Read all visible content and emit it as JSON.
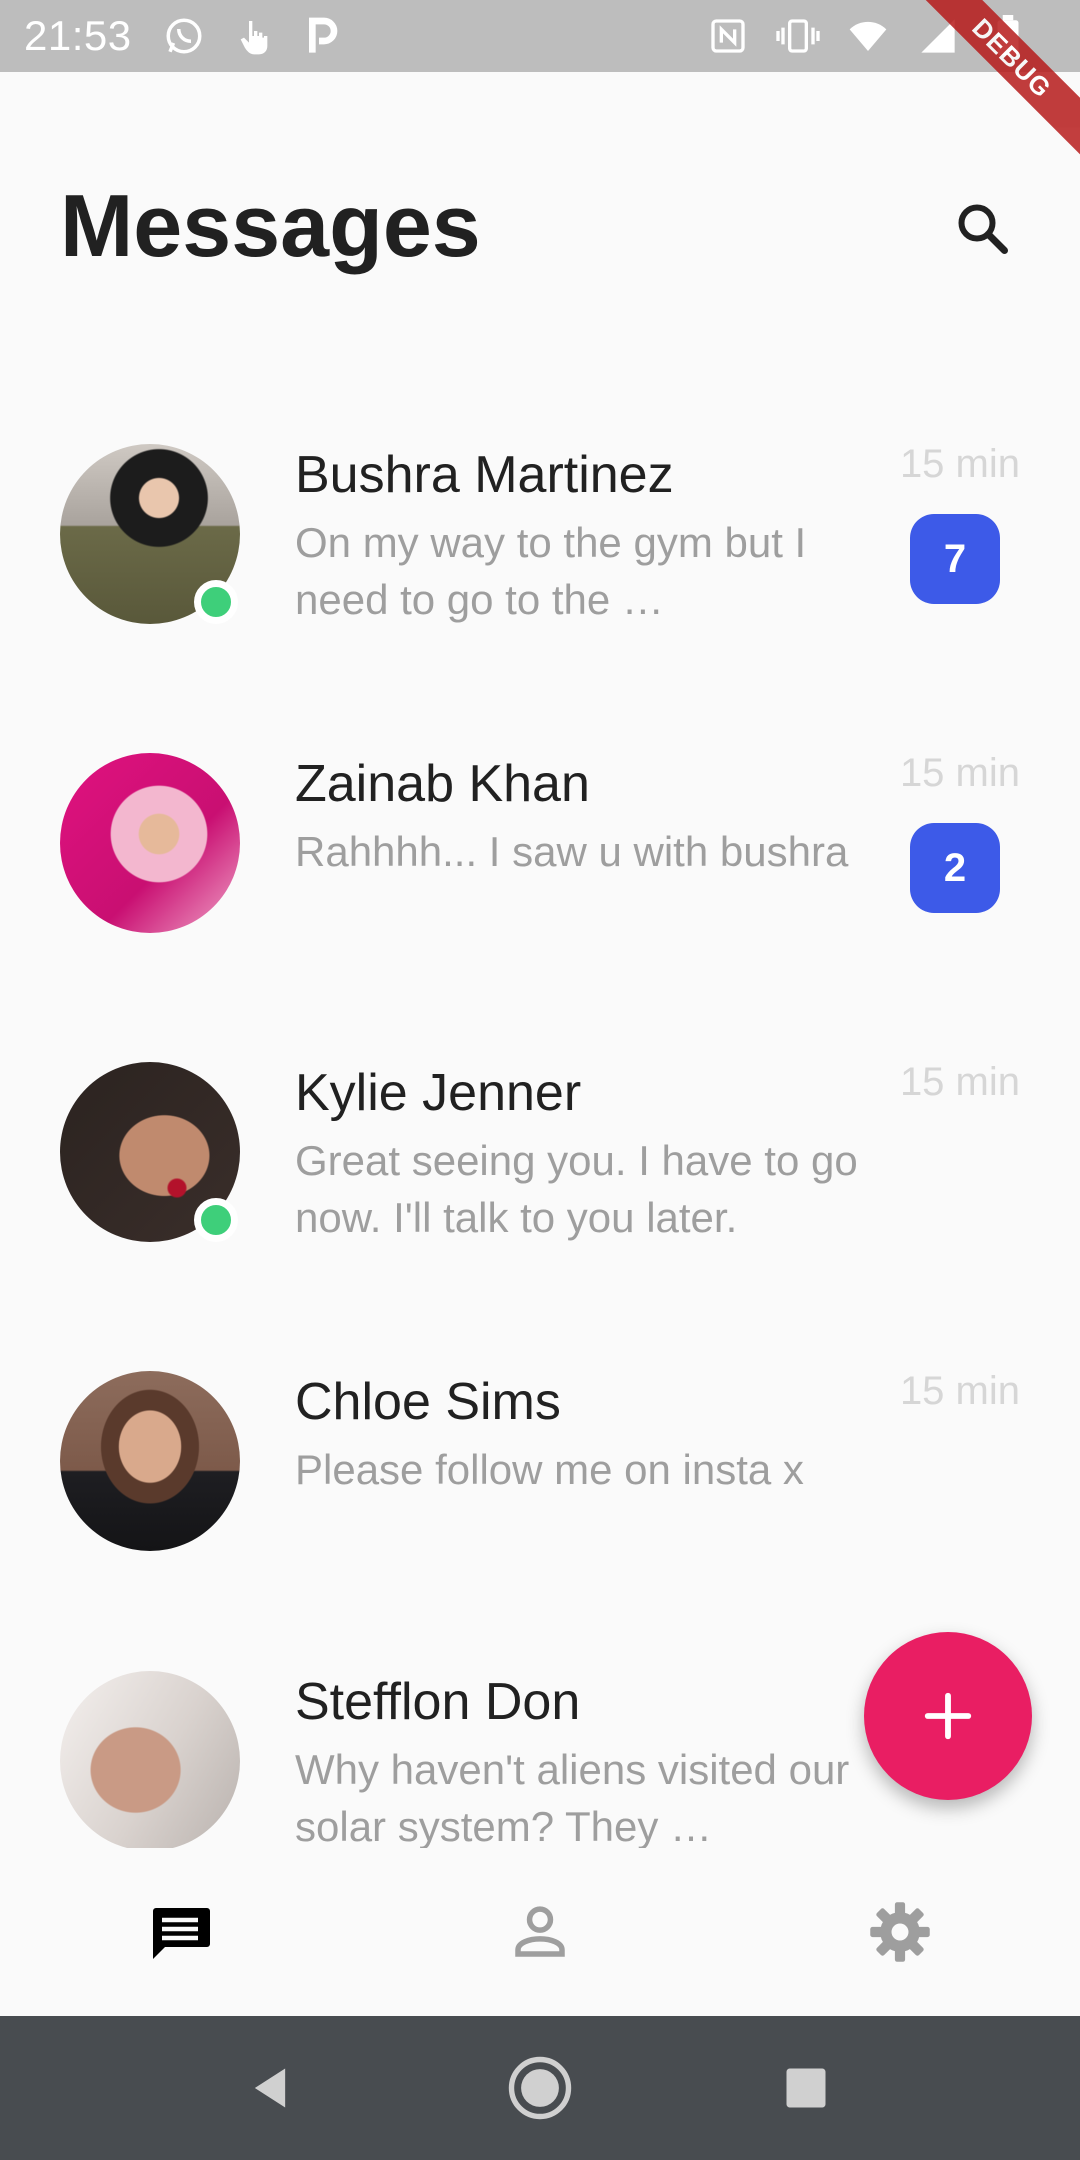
{
  "status_bar": {
    "time": "21:53",
    "left_icons": [
      "whatsapp-icon",
      "touch-icon",
      "parking-icon"
    ],
    "right_icons": [
      "nfc-icon",
      "vibrate-icon",
      "wifi-icon",
      "signal-icon",
      "battery-icon"
    ],
    "debug_label": "DEBUG"
  },
  "header": {
    "title": "Messages",
    "search_icon": "search-icon"
  },
  "messages": [
    {
      "name": "Bushra Martinez",
      "preview": "On my way to the gym but I need to go to the …",
      "time": "15 min",
      "unread": "7",
      "online": true,
      "avatar_colors": [
        "#6b6a48",
        "#1c1c1c"
      ]
    },
    {
      "name": "Zainab Khan",
      "preview": "Rahhhh... I saw u with bushra",
      "time": "15 min",
      "unread": "2",
      "online": false,
      "avatar_colors": [
        "#e0127f",
        "#f3b7cf"
      ]
    },
    {
      "name": "Kylie Jenner",
      "preview": "Great seeing you. I have to go now. I'll talk to you later.",
      "time": "15 min",
      "unread": "",
      "online": true,
      "avatar_colors": [
        "#2b2320",
        "#c08a6e"
      ]
    },
    {
      "name": "Chloe Sims",
      "preview": "Please follow me on insta x",
      "time": "15 min",
      "unread": "",
      "online": false,
      "avatar_colors": [
        "#7d5a4a",
        "#1e1e22"
      ]
    },
    {
      "name": "Stefflon Don",
      "preview": "Why haven't aliens visited our solar system? They …",
      "time": "",
      "unread": "",
      "online": false,
      "avatar_colors": [
        "#d9d2ce",
        "#b78f7f"
      ]
    }
  ],
  "fab": {
    "icon": "plus-icon"
  },
  "bottom_nav": [
    {
      "icon": "chat-icon",
      "active": true
    },
    {
      "icon": "person-icon",
      "active": false
    },
    {
      "icon": "gear-icon",
      "active": false
    }
  ],
  "system_nav": [
    "back-icon",
    "home-icon",
    "recents-icon"
  ],
  "colors": {
    "accent": "#e91e63",
    "badge": "#3d5ae8",
    "online": "#3ecf7a",
    "status_bar": "#bdbdbd",
    "system_nav": "#484c50"
  }
}
